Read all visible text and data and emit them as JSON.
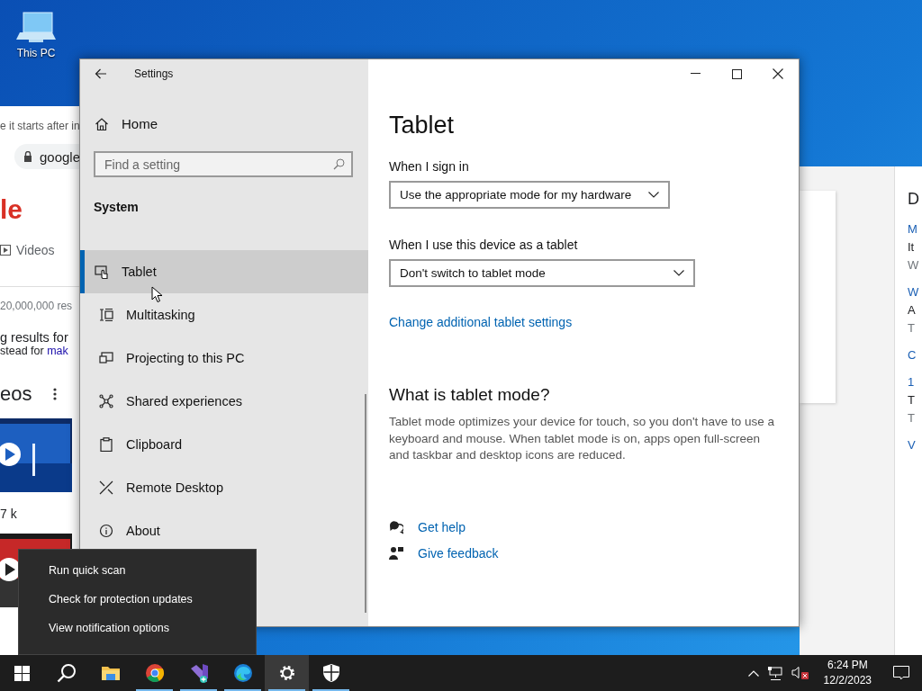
{
  "desktop": {
    "icons": [
      {
        "label": "This PC"
      }
    ]
  },
  "background_browser": {
    "left": {
      "notice": "e it starts after in",
      "address": "google",
      "logo_fragment": "le",
      "tab": "Videos",
      "result_count": "20,000,000 res",
      "heading": "g results for",
      "suggestion_prefix": "stead for ",
      "suggestion_link": "mak",
      "section": "eos",
      "views": "7 k"
    },
    "right": {
      "heading": "D",
      "items": [
        {
          "kind": "link",
          "text": "M"
        },
        {
          "kind": "text",
          "text": "It"
        },
        {
          "kind": "meta",
          "text": "W"
        },
        {
          "kind": "link",
          "text": "W"
        },
        {
          "kind": "text",
          "text": "A"
        },
        {
          "kind": "meta",
          "text": "T"
        },
        {
          "kind": "link",
          "text": "C"
        },
        {
          "kind": "link",
          "text": "1"
        },
        {
          "kind": "text",
          "text": "T"
        },
        {
          "kind": "meta",
          "text": "T"
        },
        {
          "kind": "link",
          "text": "V"
        }
      ]
    }
  },
  "window": {
    "title": "Settings",
    "home": "Home",
    "search": {
      "placeholder": "Find a setting"
    },
    "section": "System",
    "nav_items": [
      {
        "label": "Tablet",
        "selected": true
      },
      {
        "label": "Multitasking",
        "selected": false
      },
      {
        "label": "Projecting to this PC",
        "selected": false
      },
      {
        "label": "Shared experiences",
        "selected": false
      },
      {
        "label": "Clipboard",
        "selected": false
      },
      {
        "label": "Remote Desktop",
        "selected": false
      },
      {
        "label": "About",
        "selected": false
      }
    ],
    "page": {
      "title": "Tablet",
      "settings": [
        {
          "label": "When I sign in",
          "value": "Use the appropriate mode for my hardware"
        },
        {
          "label": "When I use this device as a tablet",
          "value": "Don't switch to tablet mode"
        }
      ],
      "link": "Change additional tablet settings",
      "heading": "What is tablet mode?",
      "description": "Tablet mode optimizes your device for touch, so you don't have to use a keyboard and mouse. When tablet mode is on, apps open full-screen and taskbar and desktop icons are reduced.",
      "help_links": [
        "Get help",
        "Give feedback"
      ]
    }
  },
  "context_menu": {
    "items": [
      "Run quick scan",
      "Check for protection updates",
      "View notification options"
    ]
  },
  "taskbar": {
    "apps": [
      {
        "running": false,
        "active": false
      },
      {
        "running": true,
        "active": false
      },
      {
        "running": true,
        "active": false
      },
      {
        "running": true,
        "active": false
      },
      {
        "running": true,
        "active": true
      },
      {
        "running": true,
        "active": false
      }
    ],
    "time": "6:24 PM",
    "date": "12/2/2023"
  }
}
